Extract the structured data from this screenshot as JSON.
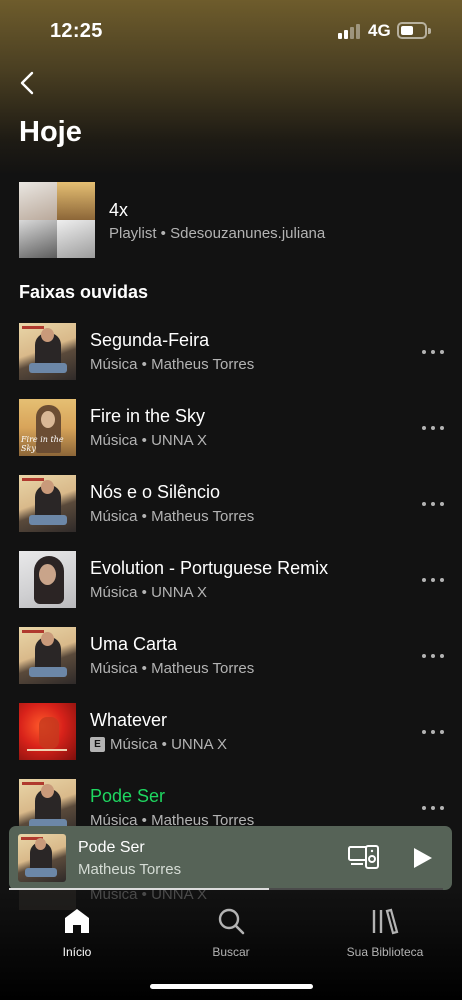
{
  "status_bar": {
    "time": "12:25",
    "network": "4G"
  },
  "header": {
    "title": "Hoje"
  },
  "playlist": {
    "title": "4x",
    "subtitle": "Playlist • Sdesouzanunes.juliana"
  },
  "section": {
    "title": "Faixas ouvidas"
  },
  "tracks": [
    {
      "title": "Segunda-Feira",
      "subtitle": "Música • Matheus Torres",
      "explicit": false,
      "active": false,
      "cover": "matheus"
    },
    {
      "title": "Fire in the Sky",
      "subtitle": "Música • UNNA X",
      "explicit": false,
      "active": false,
      "cover": "fire"
    },
    {
      "title": "Nós e o Silêncio",
      "subtitle": "Música • Matheus Torres",
      "explicit": false,
      "active": false,
      "cover": "matheus"
    },
    {
      "title": "Evolution - Portuguese Remix",
      "subtitle": "Música • UNNA X",
      "explicit": false,
      "active": false,
      "cover": "evolution"
    },
    {
      "title": "Uma Carta",
      "subtitle": "Música • Matheus Torres",
      "explicit": false,
      "active": false,
      "cover": "matheus"
    },
    {
      "title": "Whatever",
      "subtitle": "Música • UNNA X",
      "explicit": true,
      "explicit_label": "E",
      "active": false,
      "cover": "whatever"
    },
    {
      "title": "Pode Ser",
      "subtitle": "Música • Matheus Torres",
      "explicit": false,
      "active": true,
      "cover": "matheus"
    }
  ],
  "partial_row": {
    "subtitle": "Música • UNNA X"
  },
  "mini_player": {
    "title": "Pode Ser",
    "artist": "Matheus Torres",
    "progress": 0.6
  },
  "nav": {
    "items": [
      {
        "label": "Início",
        "icon": "home-icon",
        "active": true
      },
      {
        "label": "Buscar",
        "icon": "search-icon",
        "active": false
      },
      {
        "label": "Sua Biblioteca",
        "icon": "library-icon",
        "active": false
      }
    ]
  },
  "colors": {
    "accent": "#1ed760",
    "mini_player_bg": "#566357",
    "background": "#121212"
  }
}
